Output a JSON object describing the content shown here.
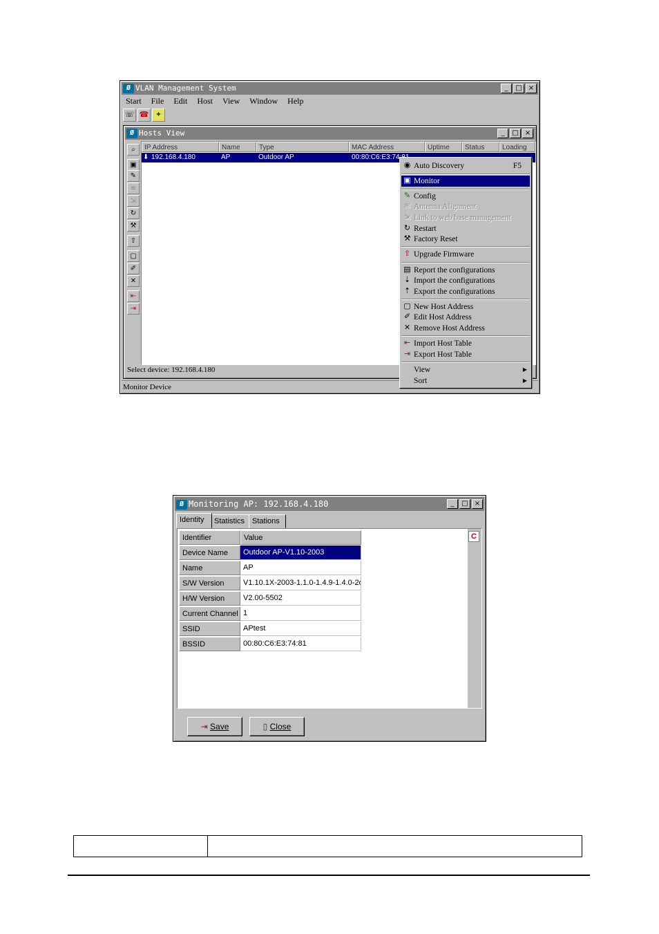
{
  "vlan_window": {
    "title": "VLAN Management System",
    "menus": [
      "Start",
      "File",
      "Edit",
      "Host",
      "View",
      "Window",
      "Help"
    ],
    "toolbar_icons": [
      "auto-discovery-icon",
      "phone-icon",
      "exit-icon"
    ],
    "window_controls": [
      "_",
      "□",
      "×"
    ],
    "status_bar": "Monitor Device"
  },
  "hosts_view": {
    "title": "Hosts View",
    "columns": [
      "IP Address",
      "Name",
      "Type",
      "MAC Address",
      "Uptime",
      "Status",
      "Loading"
    ],
    "row": {
      "ip": "192.168.4.180",
      "name": "AP",
      "type": "Outdoor AP",
      "mac": "00:80:C6:E3:74:81"
    },
    "status": "Select device: 192.168.4.180"
  },
  "context_menu": {
    "items": [
      {
        "label": "Auto Discovery",
        "shortcut": "F5",
        "icon": "binoculars-icon"
      },
      {
        "label": "Monitor",
        "icon": "monitor-icon",
        "selected": true
      },
      {
        "label": "Config",
        "icon": "config-icon"
      },
      {
        "label": "Antenna Alignment",
        "icon": "antenna-icon",
        "disabled": true
      },
      {
        "label": "Link to web base management",
        "icon": "web-link-icon",
        "disabled": true
      },
      {
        "label": "Restart",
        "icon": "restart-icon"
      },
      {
        "label": "Factory Reset",
        "icon": "factory-reset-icon"
      },
      {
        "label": "Upgrade Firmware",
        "icon": "upgrade-icon"
      },
      {
        "label": "Report the configurations",
        "icon": "report-icon"
      },
      {
        "label": "Import the configurations",
        "icon": "import-config-icon"
      },
      {
        "label": "Export the configurations",
        "icon": "export-config-icon"
      },
      {
        "label": "New Host Address",
        "icon": "new-host-icon"
      },
      {
        "label": "Edit Host Address",
        "icon": "edit-host-icon"
      },
      {
        "label": "Remove Host Address",
        "icon": "remove-host-icon"
      },
      {
        "label": "Import Host Table",
        "icon": "import-table-icon"
      },
      {
        "label": "Export Host Table",
        "icon": "export-table-icon"
      },
      {
        "label": "View",
        "submenu": true
      },
      {
        "label": "Sort",
        "submenu": true
      }
    ]
  },
  "monitor_window": {
    "title": "Monitoring AP: 192.168.4.180",
    "tabs": [
      "Identity",
      "Statistics",
      "Stations"
    ],
    "headers": [
      "Identifier",
      "Value"
    ],
    "rows": [
      {
        "id": "Device Name",
        "value": "Outdoor AP-V1.10-2003"
      },
      {
        "id": "Name",
        "value": "AP"
      },
      {
        "id": "S/W Version",
        "value": "V1.10.1X-2003-1.1.0-1.4.9-1.4.0-2o"
      },
      {
        "id": "H/W Version",
        "value": "V2.00-5502"
      },
      {
        "id": "Current Channel",
        "value": "1"
      },
      {
        "id": "SSID",
        "value": "APtest"
      },
      {
        "id": "BSSID",
        "value": "00:80:C6:E3:74:81"
      }
    ],
    "buttons": {
      "save": "Save",
      "close": "Close"
    }
  },
  "colors": {
    "title_bar": "#808080",
    "selection": "#000080",
    "face": "#c0c0c0"
  }
}
